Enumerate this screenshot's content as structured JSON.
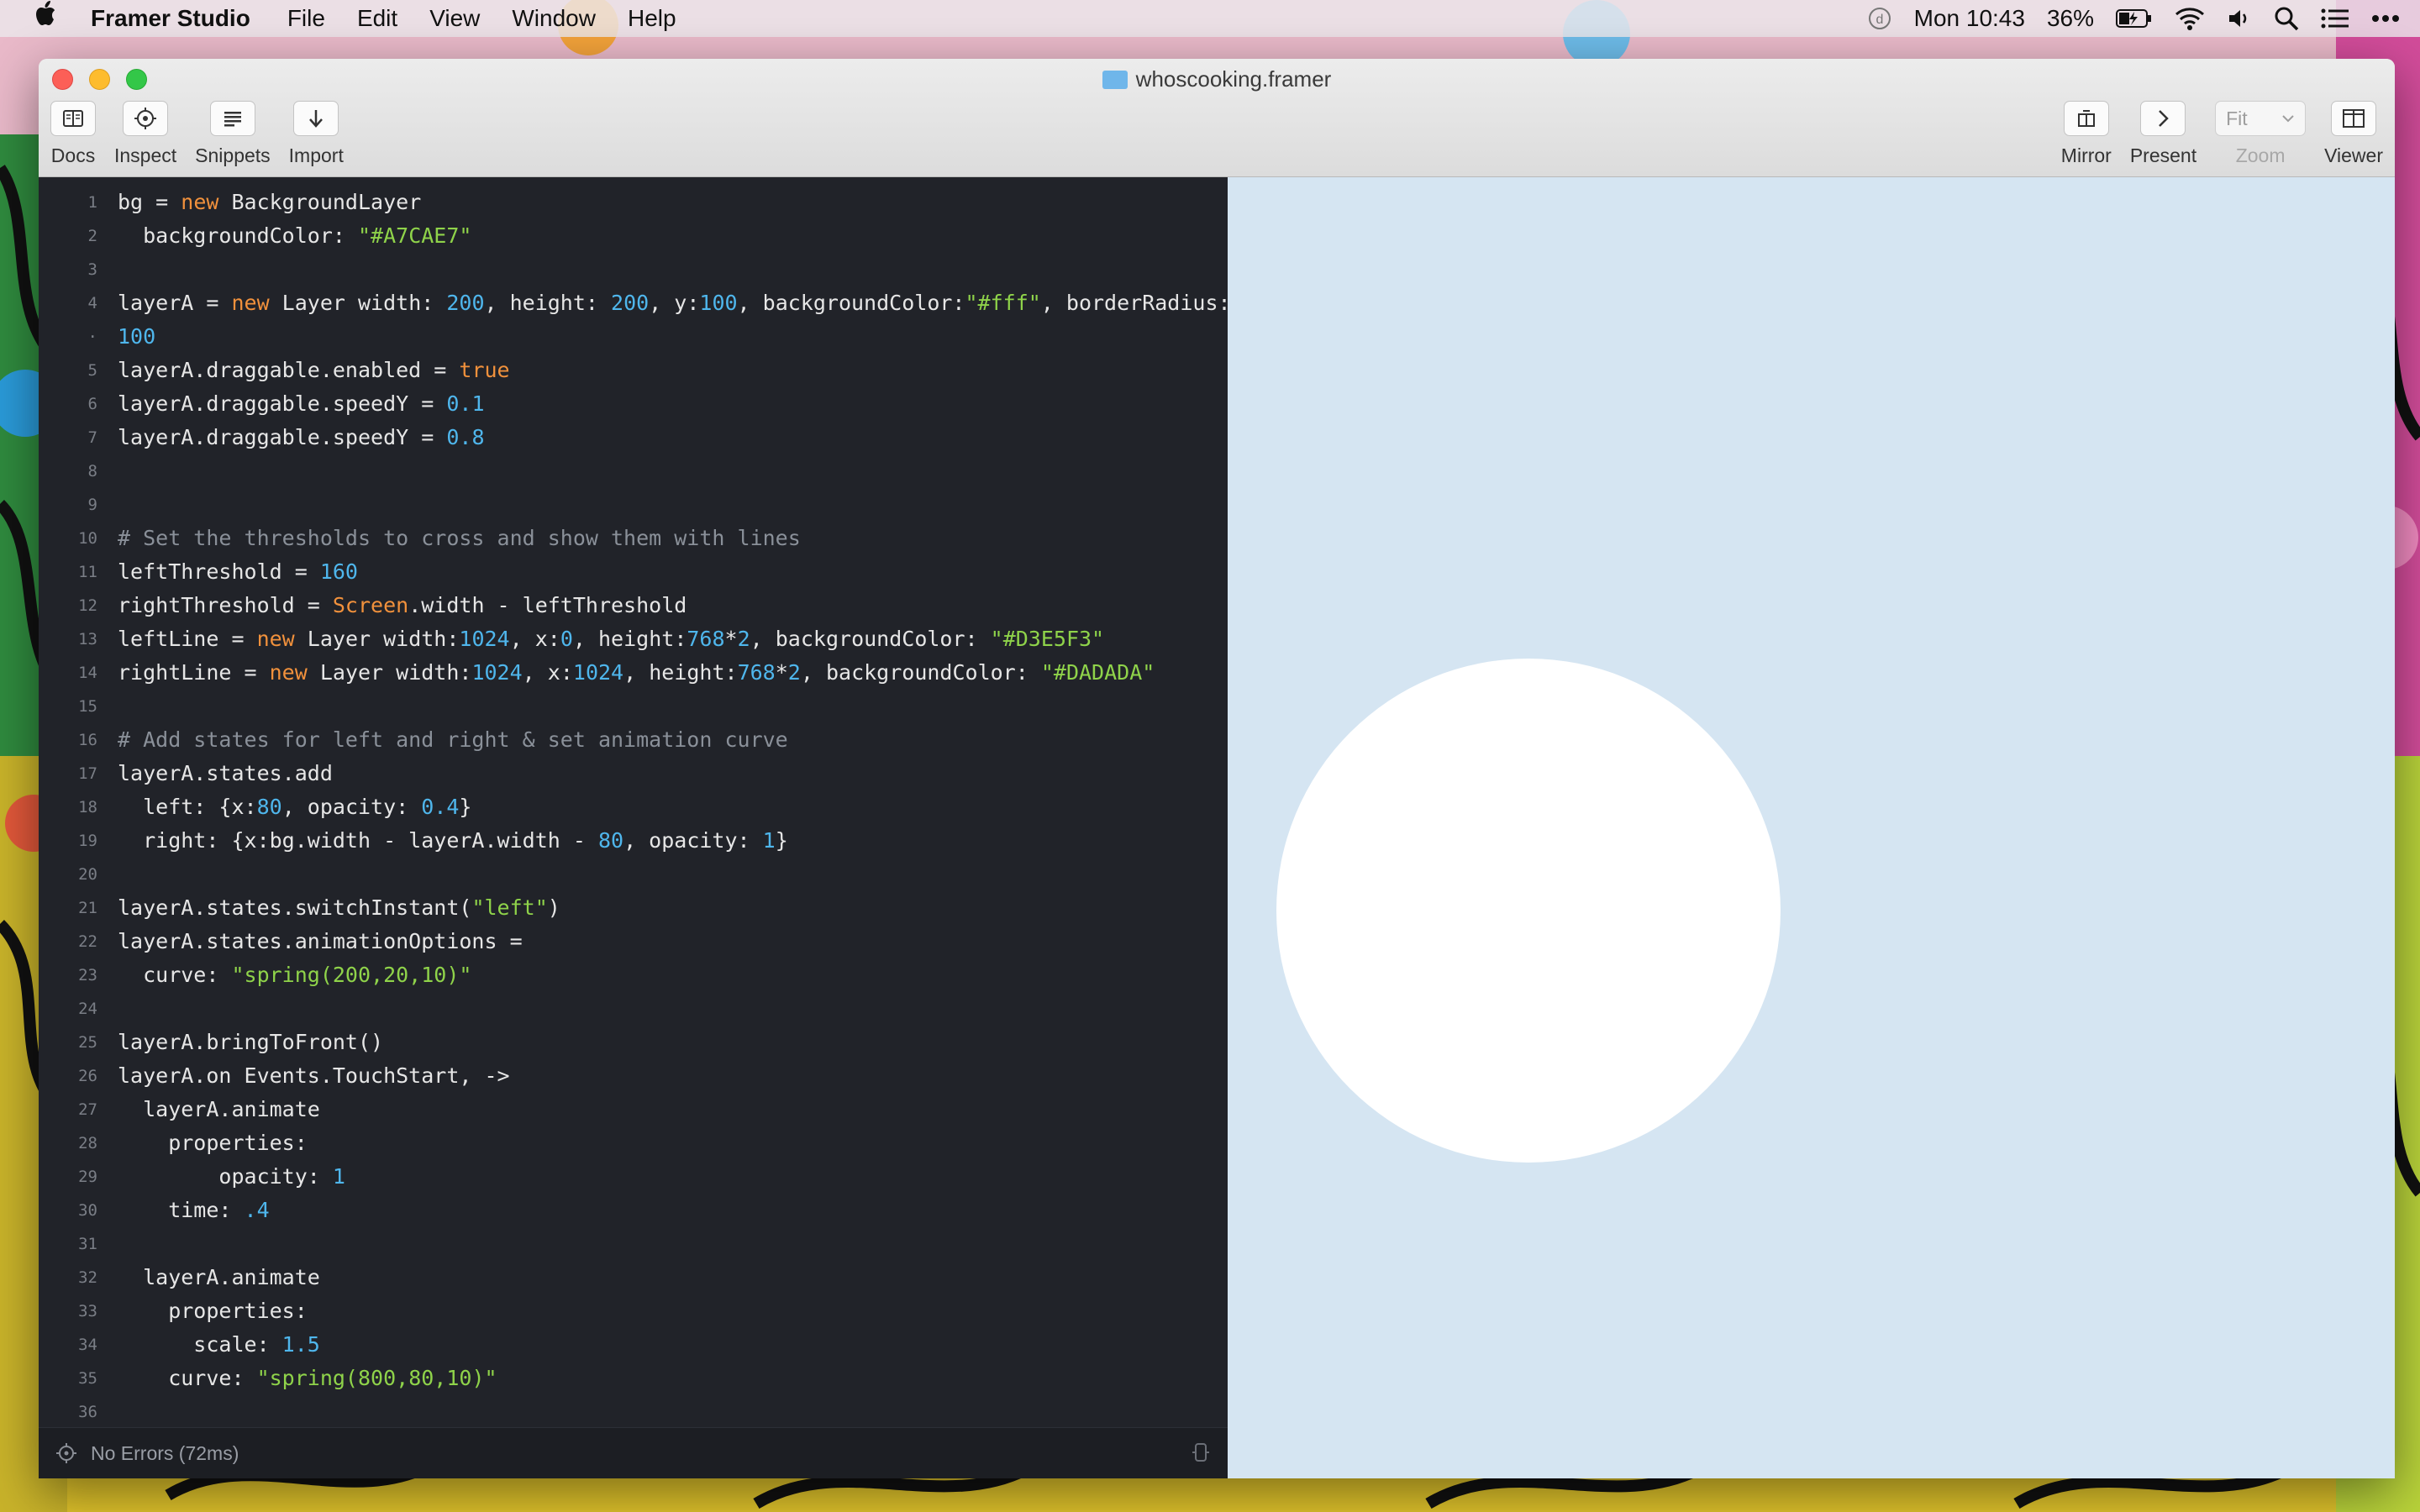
{
  "menubar": {
    "app_name": "Framer Studio",
    "menus": [
      "File",
      "Edit",
      "View",
      "Window",
      "Help"
    ],
    "clock": "Mon 10:43",
    "battery": "36%"
  },
  "window": {
    "title": "whoscooking.framer",
    "toolbar_left": [
      {
        "label": "Docs",
        "icon": "docs-icon"
      },
      {
        "label": "Inspect",
        "icon": "inspect-icon"
      },
      {
        "label": "Snippets",
        "icon": "snippets-icon"
      },
      {
        "label": "Import",
        "icon": "import-icon"
      }
    ],
    "toolbar_right": {
      "mirror": "Mirror",
      "present": "Present",
      "zoom_value": "Fit",
      "zoom_label": "Zoom",
      "viewer": "Viewer"
    }
  },
  "editor": {
    "lines": [
      {
        "n": "1",
        "tokens": [
          [
            "p",
            "bg = "
          ],
          [
            "kw",
            "new"
          ],
          [
            "p",
            " BackgroundLayer"
          ]
        ]
      },
      {
        "n": "2",
        "tokens": [
          [
            "p",
            "  backgroundColor: "
          ],
          [
            "str",
            "\"#A7CAE7\""
          ]
        ]
      },
      {
        "n": "3",
        "tokens": []
      },
      {
        "n": "4",
        "tokens": [
          [
            "p",
            "layerA = "
          ],
          [
            "kw",
            "new"
          ],
          [
            "p",
            " Layer width: "
          ],
          [
            "num",
            "200"
          ],
          [
            "p",
            ", height: "
          ],
          [
            "num",
            "200"
          ],
          [
            "p",
            ", y:"
          ],
          [
            "num",
            "100"
          ],
          [
            "p",
            ", backgroundColor:"
          ],
          [
            "str",
            "\"#fff\""
          ],
          [
            "p",
            ", borderRadius:"
          ]
        ]
      },
      {
        "n": "·",
        "tokens": [
          [
            "num",
            "100"
          ]
        ]
      },
      {
        "n": "5",
        "tokens": [
          [
            "p",
            "layerA.draggable.enabled = "
          ],
          [
            "kw",
            "true"
          ]
        ]
      },
      {
        "n": "6",
        "tokens": [
          [
            "p",
            "layerA.draggable.speedY = "
          ],
          [
            "num",
            "0.1"
          ]
        ]
      },
      {
        "n": "7",
        "tokens": [
          [
            "p",
            "layerA.draggable.speedY = "
          ],
          [
            "num",
            "0.8"
          ]
        ]
      },
      {
        "n": "8",
        "tokens": []
      },
      {
        "n": "9",
        "tokens": []
      },
      {
        "n": "10",
        "tokens": [
          [
            "com",
            "# Set the thresholds to cross and show them with lines"
          ]
        ]
      },
      {
        "n": "11",
        "tokens": [
          [
            "p",
            "leftThreshold = "
          ],
          [
            "num",
            "160"
          ]
        ]
      },
      {
        "n": "12",
        "tokens": [
          [
            "p",
            "rightThreshold = "
          ],
          [
            "kw",
            "Screen"
          ],
          [
            "p",
            ".width - leftThreshold"
          ]
        ]
      },
      {
        "n": "13",
        "tokens": [
          [
            "p",
            "leftLine = "
          ],
          [
            "kw",
            "new"
          ],
          [
            "p",
            " Layer width:"
          ],
          [
            "num",
            "1024"
          ],
          [
            "p",
            ", x:"
          ],
          [
            "num",
            "0"
          ],
          [
            "p",
            ", height:"
          ],
          [
            "num",
            "768"
          ],
          [
            "p",
            "*"
          ],
          [
            "num",
            "2"
          ],
          [
            "p",
            ", backgroundColor: "
          ],
          [
            "str",
            "\"#D3E5F3\""
          ]
        ]
      },
      {
        "n": "14",
        "tokens": [
          [
            "p",
            "rightLine = "
          ],
          [
            "kw",
            "new"
          ],
          [
            "p",
            " Layer width:"
          ],
          [
            "num",
            "1024"
          ],
          [
            "p",
            ", x:"
          ],
          [
            "num",
            "1024"
          ],
          [
            "p",
            ", height:"
          ],
          [
            "num",
            "768"
          ],
          [
            "p",
            "*"
          ],
          [
            "num",
            "2"
          ],
          [
            "p",
            ", backgroundColor: "
          ],
          [
            "str",
            "\"#DADADA\""
          ]
        ]
      },
      {
        "n": "15",
        "tokens": []
      },
      {
        "n": "16",
        "tokens": [
          [
            "com",
            "# Add states for left and right & set animation curve"
          ]
        ]
      },
      {
        "n": "17",
        "tokens": [
          [
            "p",
            "layerA.states.add"
          ]
        ]
      },
      {
        "n": "18",
        "tokens": [
          [
            "p",
            "  left: {x:"
          ],
          [
            "num",
            "80"
          ],
          [
            "p",
            ", opacity: "
          ],
          [
            "num",
            "0.4"
          ],
          [
            "p",
            "}"
          ]
        ]
      },
      {
        "n": "19",
        "tokens": [
          [
            "p",
            "  right: {x:bg.width - layerA.width - "
          ],
          [
            "num",
            "80"
          ],
          [
            "p",
            ", opacity: "
          ],
          [
            "num",
            "1"
          ],
          [
            "p",
            "}"
          ]
        ]
      },
      {
        "n": "20",
        "tokens": []
      },
      {
        "n": "21",
        "tokens": [
          [
            "p",
            "layerA.states.switchInstant("
          ],
          [
            "str",
            "\"left\""
          ],
          [
            "p",
            ")"
          ]
        ]
      },
      {
        "n": "22",
        "tokens": [
          [
            "p",
            "layerA.states.animationOptions ="
          ]
        ]
      },
      {
        "n": "23",
        "tokens": [
          [
            "p",
            "  curve: "
          ],
          [
            "str",
            "\"spring(200,20,10)\""
          ]
        ]
      },
      {
        "n": "24",
        "tokens": []
      },
      {
        "n": "25",
        "tokens": [
          [
            "p",
            "layerA.bringToFront()"
          ]
        ]
      },
      {
        "n": "26",
        "tokens": [
          [
            "p",
            "layerA.on Events.TouchStart, ->"
          ]
        ]
      },
      {
        "n": "27",
        "tokens": [
          [
            "p",
            "  layerA.animate"
          ]
        ]
      },
      {
        "n": "28",
        "tokens": [
          [
            "p",
            "    properties:"
          ]
        ]
      },
      {
        "n": "29",
        "tokens": [
          [
            "p",
            "        opacity: "
          ],
          [
            "num",
            "1"
          ]
        ]
      },
      {
        "n": "30",
        "tokens": [
          [
            "p",
            "    time: "
          ],
          [
            "num",
            ".4"
          ]
        ]
      },
      {
        "n": "31",
        "tokens": []
      },
      {
        "n": "32",
        "tokens": [
          [
            "p",
            "  layerA.animate"
          ]
        ]
      },
      {
        "n": "33",
        "tokens": [
          [
            "p",
            "    properties:"
          ]
        ]
      },
      {
        "n": "34",
        "tokens": [
          [
            "p",
            "      scale: "
          ],
          [
            "num",
            "1.5"
          ]
        ]
      },
      {
        "n": "35",
        "tokens": [
          [
            "p",
            "    curve: "
          ],
          [
            "str",
            "\"spring(800,80,10)\""
          ]
        ]
      },
      {
        "n": "36",
        "tokens": []
      }
    ],
    "status": "No Errors (72ms)"
  },
  "preview": {
    "background_color": "#d5e5f2",
    "layer_color": "#ffffff"
  }
}
